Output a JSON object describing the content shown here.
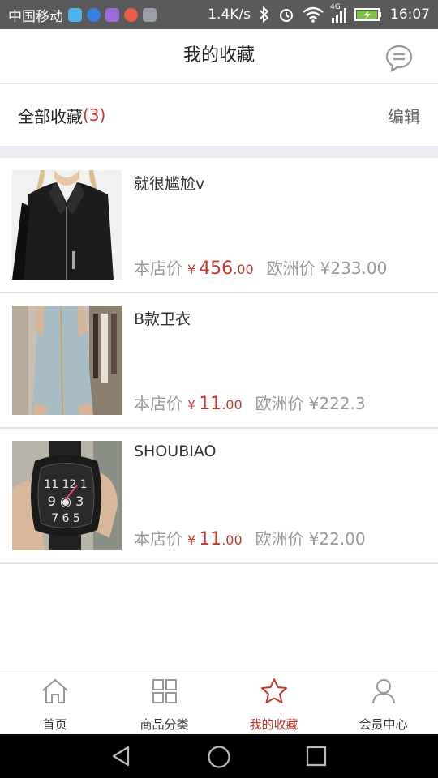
{
  "status_bar": {
    "carrier": "中国移动",
    "speed": "1.4K/s",
    "network": "4G",
    "time": "16:07",
    "app_icons": [
      "#4fb3e8",
      "#3a7ee0",
      "#9b6bd6",
      "#e85c4a",
      "#9aa0a6"
    ]
  },
  "header": {
    "title": "我的收藏"
  },
  "summary": {
    "label": "全部收藏",
    "count": "(3)",
    "edit_label": "编辑"
  },
  "items": [
    {
      "name": "就很尴尬v",
      "store_label": "本店价",
      "currency": "¥",
      "price_int": "456",
      "price_dec": ".00",
      "eu_label": "欧洲价",
      "eu_price": "¥233.00",
      "image": "black-leather-jacket"
    },
    {
      "name": "B款卫衣",
      "store_label": "本店价",
      "currency": "¥",
      "price_int": "11",
      "price_dec": ".00",
      "eu_label": "欧洲价",
      "eu_price": "¥222.3",
      "image": "light-blue-dress"
    },
    {
      "name": "SHOUBIAO",
      "store_label": "本店价",
      "currency": "¥",
      "price_int": "11",
      "price_dec": ".00",
      "eu_label": "欧洲价",
      "eu_price": "¥22.00",
      "image": "black-watch"
    }
  ],
  "bottom_nav": [
    {
      "label": "首页",
      "icon": "home-icon",
      "active": false
    },
    {
      "label": "商品分类",
      "icon": "grid-icon",
      "active": false
    },
    {
      "label": "我的收藏",
      "icon": "star-icon",
      "active": true
    },
    {
      "label": "会员中心",
      "icon": "user-icon",
      "active": false
    }
  ],
  "colors": {
    "accent": "#c0392b",
    "status_bar": "#5a5a5a",
    "muted": "#999999"
  }
}
